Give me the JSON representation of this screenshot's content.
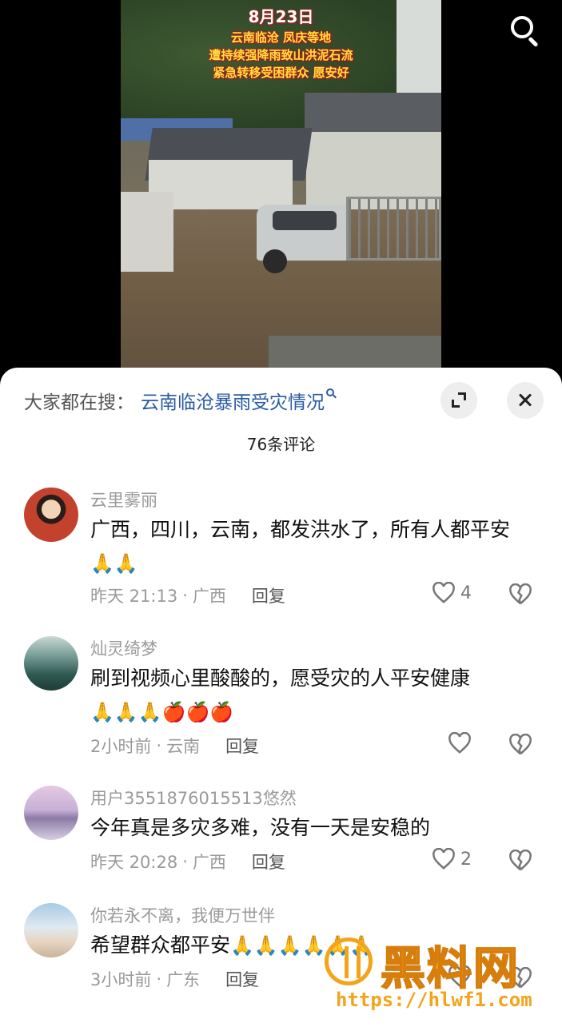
{
  "video": {
    "caption_date": "8月23日",
    "caption_lines": [
      "云南临沧 凤庆等地",
      "遭持续强降雨致山洪泥石流",
      "紧急转移受困群众 愿安好"
    ]
  },
  "top_bar": {
    "search_icon": "search-icon"
  },
  "hot_search": {
    "prefix": "大家都在搜：",
    "keyword": "云南临沧暴雨受灾情况",
    "icons": {
      "keyword": "search-small-icon",
      "expand": "expand-icon",
      "close": "close-icon"
    }
  },
  "comments_count": "76条评论",
  "comments": [
    {
      "user": "云里雾丽",
      "text": "广西，四川，云南，都发洪水了，所有人都平安",
      "emoji": "🙏🙏",
      "time": "昨天 21:13",
      "location": "广西",
      "reply": "回复",
      "likes": "4",
      "avatar_color": "#c2422e"
    },
    {
      "user": "灿灵绮梦",
      "text": "刷到视频心里酸酸的，愿受灾的人平安健康",
      "emoji": "🙏🙏🙏🍎🍎🍎",
      "time": "2小时前",
      "location": "云南",
      "reply": "回复",
      "likes": "",
      "avatar_color": "#3d6a63"
    },
    {
      "user": "用户3551876015513悠然",
      "text": "今年真是多灾多难，没有一天是安稳的",
      "emoji": "",
      "time": "昨天 20:28",
      "location": "广西",
      "reply": "回复",
      "likes": "2",
      "avatar_color": "#b7a7c8"
    },
    {
      "user": "你若永不离，我便万世伴",
      "text": "希望群众都平安",
      "emoji": "🙏🙏🙏🙏🙏🙏",
      "time": "3小时前",
      "location": "广东",
      "reply": "回复",
      "likes": "",
      "avatar_color": "#8fb7d6"
    }
  ],
  "watermark": {
    "brand": "黑料网",
    "url": "https://hlwf1.com"
  },
  "colors": {
    "link": "#2a5aa3",
    "meta": "#9a9a9a",
    "caption_yellow": "#ffe23a",
    "watermark": "#f3a41b"
  }
}
